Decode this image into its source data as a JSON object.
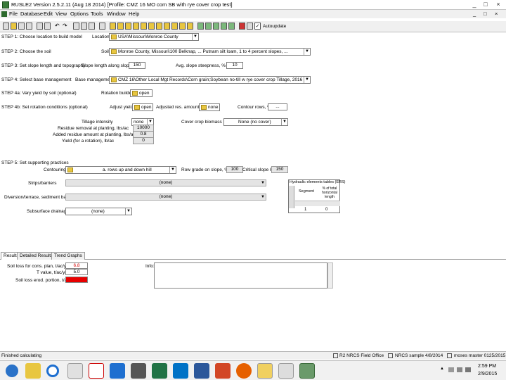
{
  "window": {
    "title": "RUSLE2 Version 2.5.2.11 (Aug 18 2014)  [Profile: CMZ 16 MO com SB with rye cover crop test]",
    "controls": [
      "_",
      "□",
      "×"
    ]
  },
  "menu": [
    "File",
    "Database",
    "Edit",
    "View",
    "Options",
    "Tools",
    "Window",
    "Help"
  ],
  "toolbar": {
    "autoupdate_label": "Autoupdate",
    "autoupdate_checked": true
  },
  "steps": {
    "step1": {
      "label": "STEP 1: Choose location to build model",
      "field_label": "Location",
      "value": "USA\\Missouri\\Monroe County"
    },
    "step2": {
      "label": "STEP 2: Choose the soil",
      "field_label": "Soil",
      "value": "Monroe County, Missouri\\100 Belknap, ... Putnam silt loam, 1 to 4 percent slopes, ..."
    },
    "step3": {
      "label": "STEP 3: Set slope length and topography",
      "length_label": "Slope length along slope, ft",
      "length_value": "150",
      "steep_label": "Avg. slope steepness, %",
      "steep_value": "10"
    },
    "step4": {
      "label": "STEP 4: Select base management",
      "field_label": "Base management",
      "value": "CMZ 16\\Other Local Mgt Records\\Corn grain;Soybean no-till w rye cover crop Tillage, 2016"
    },
    "step4a": {
      "label": "STEP 4a: Vary yield by soil (optional)",
      "field_label": "Rotation builder",
      "value": "open"
    },
    "step4b": {
      "label": "STEP 4b: Set rotation conditions (optional)",
      "adjust_label": "Adjust yields",
      "adjust_value": "open",
      "adjusted_label": "Adjusted res. amounts",
      "adjusted_value": "none",
      "contour_label": "Contour rows, %",
      "contour_value": "..."
    },
    "step4b_detail": {
      "tillage_label": "Tillage intensity",
      "tillage_value": "none",
      "cover_label": "Cover crop biomass",
      "cover_value": "None (no cover)",
      "residue_label": "Residue removal at planting, lbs/ac",
      "residue_value": "10000",
      "add_label": "Added residue amount at planting, lbs/ac",
      "add_value": "0.8",
      "yield_label": "Yield (for a rotation), lb/ac",
      "yield_value": "0"
    },
    "step5": {
      "label": "STEP 5: Set supporting practices",
      "contouring_label": "Contouring",
      "contouring_value": "a. rows up and down hill",
      "grade_label": "Row grade on slope, %",
      "grade_value": "100",
      "critical_label": "Critical slope length, ft",
      "critical_value": "150",
      "strip_label": "Strips/barriers",
      "strip_value": "(none)",
      "diversion_label": "Diversion/terrace, sediment basin",
      "diversion_value": "(none)",
      "subsurface_label": "Subsurface drainage",
      "subsurface_value": "(none)"
    }
  },
  "results_table": {
    "title": "Hydraulic elements tables (ERS)",
    "headers": [
      "Segment",
      "% of total horizontal length"
    ],
    "row": [
      "1",
      "0"
    ]
  },
  "bottom_tabs": [
    "Results",
    "Detailed Results",
    "Trend Graphs"
  ],
  "results": {
    "soil_loss_label": "Soil loss for cons. plan, t/ac/yr",
    "soil_loss_value": "6.8",
    "t_label": "T value, t/ac/yr",
    "t_value": "5.0",
    "erosion_label": "Soil loss erod. portion, t/ac/yr",
    "erosion_value": "",
    "info_label": "Info:"
  },
  "status": {
    "left": "Finished calculating",
    "right": [
      "R2 NRCS Field Office",
      "NRCS sample 4/8/2014",
      "moses master 0125/2015"
    ]
  },
  "taskbar": {
    "icons": [
      "start-icon",
      "file-explorer-icon",
      "ie-icon",
      "media-icon",
      "pdf-icon",
      "lync-icon",
      "calculator-icon",
      "excel-icon",
      "outlook-icon",
      "word-icon",
      "powerpoint-icon",
      "firefox-icon",
      "paint-icon",
      "snipping-icon",
      "rusle2-icon"
    ],
    "time": "2:59 PM",
    "date": "2/9/2015"
  },
  "colors": {
    "soil_loss_bg": "#e80000",
    "folder": "#e8c640",
    "accent": "#1a55b0"
  }
}
